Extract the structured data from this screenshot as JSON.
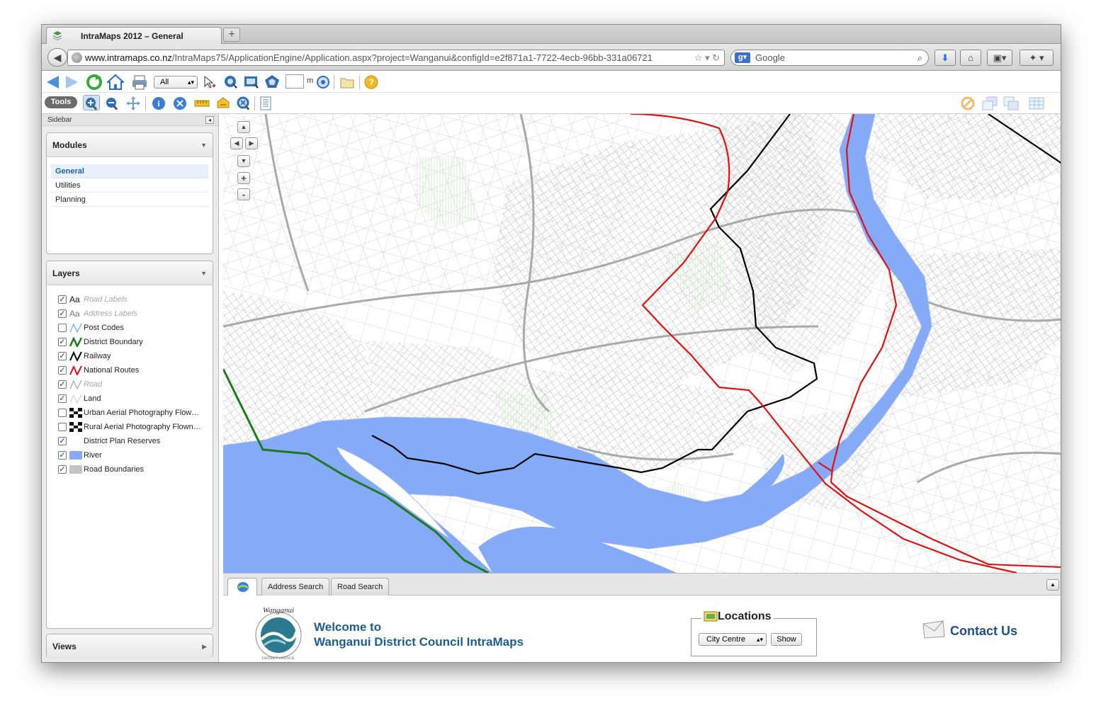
{
  "browser": {
    "tab_title": "IntraMaps 2012 – General",
    "new_tab": "+",
    "url_host": "www.intramaps.co.nz",
    "url_path": "/IntraMaps75/ApplicationEngine/Application.aspx?project=Wanganui&configId=e2f871a1-7722-4ecb-96bb-331a06721",
    "search_placeholder": "Google"
  },
  "toolbar": {
    "select_value": "All",
    "scale_unit": "m",
    "tools_label": "Tools"
  },
  "sidebar": {
    "label": "Sidebar",
    "modules_title": "Modules",
    "modules": [
      {
        "label": "General",
        "active": true
      },
      {
        "label": "Utilities"
      },
      {
        "label": "Planning"
      }
    ],
    "layers_title": "Layers",
    "layers": [
      {
        "label": "Road Labels",
        "sym": "Aa",
        "checked": true,
        "dim": true
      },
      {
        "label": "Address Labels",
        "sym": "Aa",
        "checked": true,
        "dim": true
      },
      {
        "label": "Post Codes",
        "checked": false
      },
      {
        "label": "District Boundary",
        "checked": true
      },
      {
        "label": "Railway",
        "checked": true
      },
      {
        "label": "National Routes",
        "checked": true
      },
      {
        "label": "Road",
        "checked": true,
        "dim": true
      },
      {
        "label": "Land",
        "checked": true
      },
      {
        "label": "Urban Aerial Photography Flow…",
        "checked": false
      },
      {
        "label": "Rural Aerial Photography Flown…",
        "checked": false
      },
      {
        "label": "District Plan Reserves",
        "checked": true
      },
      {
        "label": "River",
        "checked": true
      },
      {
        "label": "Road Boundaries",
        "checked": true
      }
    ],
    "views_title": "Views"
  },
  "bottom": {
    "tabs": [
      "Address Search",
      "Road Search"
    ],
    "welcome_line1": "Welcome to",
    "welcome_line2": "Wanganui District Council IntraMaps",
    "logo_text": "Wanganui",
    "logo_subtext": "DISTRICT COUNCIL",
    "locations_title": "Locations",
    "locations_selected": "City Centre",
    "show_button": "Show",
    "contact": "Contact Us"
  },
  "colors": {
    "river": "#84aaf8",
    "district_boundary": "#1f7a1f",
    "national_routes": "#e01010",
    "railway": "#000000",
    "roads": "#b4b4b4",
    "accent": "#1d5d8e"
  }
}
